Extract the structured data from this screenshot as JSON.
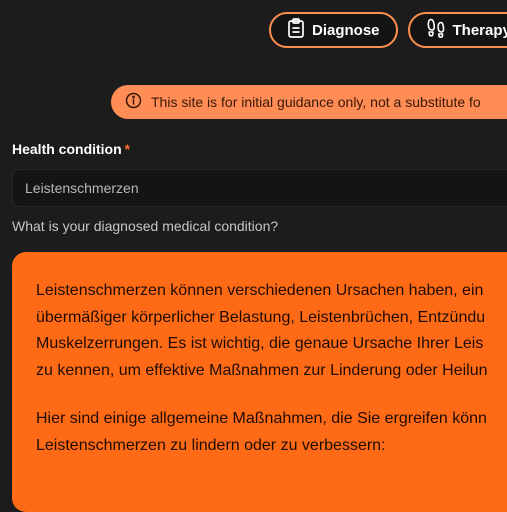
{
  "nav": {
    "diagnose_label": "Diagnose",
    "therapy_label": "Therapy"
  },
  "alert": {
    "text": "This site is for initial guidance only, not a substitute fo"
  },
  "field": {
    "label": "Health condition",
    "required_marker": "*",
    "value": "Leistenschmerzen",
    "helper": "What is your diagnosed medical condition?"
  },
  "response": {
    "paragraphs": [
      [
        "Leistenschmerzen können verschiedenen Ursachen haben, ein",
        "übermäßiger körperlicher Belastung, Leistenbrüchen, Entzündu",
        "Muskelzerrungen. Es ist wichtig, die genaue Ursache Ihrer Leis",
        "zu kennen, um effektive Maßnahmen zur Linderung oder Heilun"
      ],
      [
        "Hier sind einige allgemeine Maßnahmen, die Sie ergreifen könn",
        "Leistenschmerzen zu lindern oder zu verbessern:"
      ]
    ]
  },
  "colors": {
    "background": "#1c1c1c",
    "accent_border": "#ff8f4f",
    "alert_background": "#ff8d55",
    "response_background": "#ff6a17",
    "required": "#ff6a2a"
  },
  "icons": {
    "diagnose": "clipboard-icon",
    "therapy": "footprints-icon",
    "alert": "info-icon"
  }
}
